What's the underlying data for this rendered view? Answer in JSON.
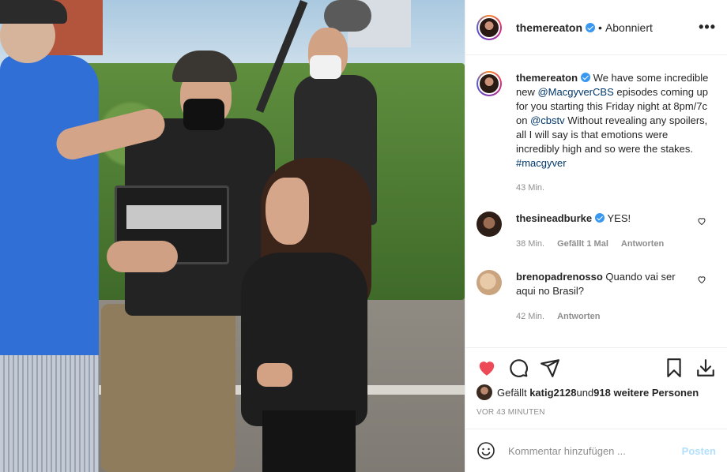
{
  "post": {
    "author": "themereaton",
    "follow_status": "Abonniert",
    "more_label": "•••",
    "caption_user": "themereaton",
    "caption_parts": {
      "p1": "We have some incredible new ",
      "mention1": "@MacgyverCBS",
      "p2": " episodes coming up for you starting this Friday night at 8pm/7c on ",
      "mention2": "@cbstv",
      "p3": " Without revealing any spoilers, all I will say is that emotions were incredibly high and so were the stakes. ",
      "hashtag": "#macgyver"
    },
    "caption_time": "43 Min."
  },
  "comments": [
    {
      "user": "thesineadburke",
      "text": "YES!",
      "time": "38 Min.",
      "likes": "Gefällt 1 Mal",
      "reply": "Antworten"
    },
    {
      "user": "brenopadrenosso",
      "text": "Quando vai ser aqui no Brasil?",
      "time": "42 Min.",
      "reply": "Antworten"
    }
  ],
  "actions": {
    "likes_prefix": "Gefällt",
    "likes_user": "katig2128",
    "likes_middle": " und ",
    "likes_count": "918 weitere Personen",
    "post_time": "VOR 43 MINUTEN"
  },
  "add_comment": {
    "placeholder": "Kommentar hinzufügen ...",
    "post_label": "Posten"
  },
  "colors": {
    "like_red": "#ed4956",
    "link_blue": "#00376b",
    "verified_blue": "#3897f0"
  },
  "icons": {
    "like": "heart-icon",
    "comment": "comment-icon",
    "share": "share-icon",
    "save": "bookmark-icon",
    "download": "download-icon",
    "emoji": "emoji-icon"
  }
}
